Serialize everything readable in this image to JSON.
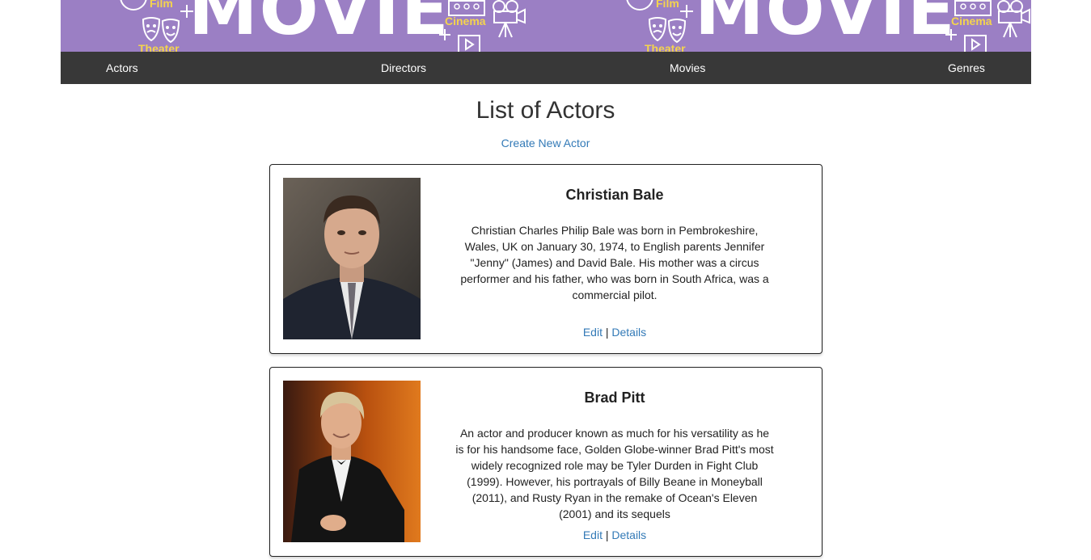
{
  "banner": {
    "word": "MOVIE",
    "labels": [
      "Film",
      "Theater",
      "Cinema"
    ]
  },
  "nav": {
    "items": [
      "Actors",
      "Directors",
      "Movies",
      "Genres"
    ]
  },
  "page": {
    "title": "List of Actors",
    "create_link": "Create New Actor"
  },
  "actors": [
    {
      "name": "Christian Bale",
      "bio": "Christian Charles Philip Bale was born in Pembrokeshire, Wales, UK on January 30, 1974, to English parents Jennifer \"Jenny\" (James) and David Bale. His mother was a circus performer and his father, who was born in South Africa, was a commercial pilot.",
      "edit_label": "Edit",
      "separator": "|",
      "details_label": "Details"
    },
    {
      "name": "Brad Pitt",
      "bio": "An actor and producer known as much for his versatility as he is for his handsome face, Golden Globe-winner Brad Pitt's most widely recognized role may be Tyler Durden in Fight Club (1999). However, his portrayals of Billy Beane in Moneyball (2011), and Rusty Ryan in the remake of Ocean's Eleven (2001) and its sequels",
      "edit_label": "Edit",
      "separator": "|",
      "details_label": "Details"
    }
  ],
  "colors": {
    "banner": "#9b7fc4",
    "navbar": "#383838",
    "link": "#337ab7",
    "banner_accent": "#f4d44d"
  }
}
